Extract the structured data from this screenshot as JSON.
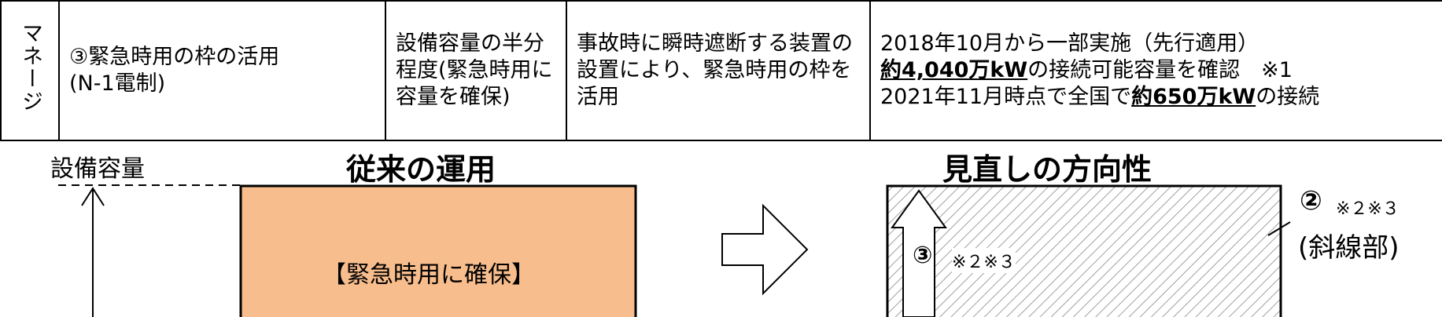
{
  "table": {
    "side_label": "マネージ",
    "item": "③緊急時用の枠の活用",
    "item_sub": "(N-1電制)",
    "capacity_note": "設備容量の半分程度(緊急時用に容量を確保)",
    "description": "事故時に瞬時遮断する装置の設置により、緊急時用の枠を活用",
    "status_line1": "2018年10月から一部実施（先行適用）",
    "status_line2_bold": "約4,040万kW",
    "status_line2_rest": "の接続可能容量を確認　※1",
    "status_line3_pre": "2021年11月時点で全国で",
    "status_line3_bold": "約650万kW",
    "status_line3_post": "の接続"
  },
  "diagram": {
    "axis_label": "設備容量",
    "left_title": "従来の運用",
    "left_box_label": "【緊急時用に確保】",
    "right_title": "見直しの方向性",
    "circle2": "②",
    "note2": "※２※３",
    "hatched_label": "(斜線部)",
    "circle3": "③",
    "note3": "※２※３"
  },
  "colors": {
    "orange_fill": "#F8BD8C",
    "border": "#000000",
    "hatch": "#A0A0A0"
  }
}
